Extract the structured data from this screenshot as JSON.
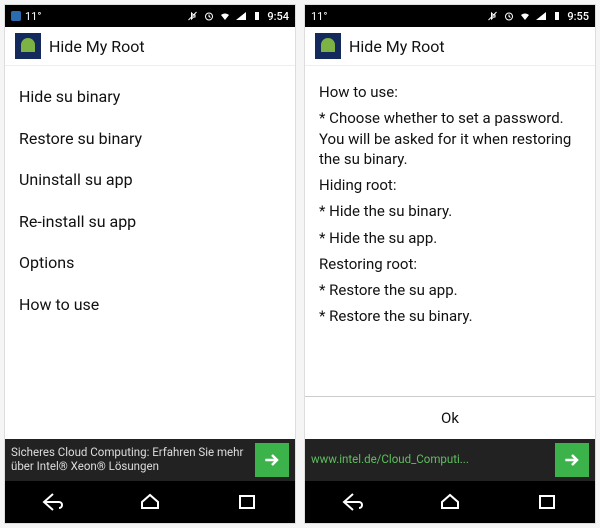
{
  "left": {
    "status": {
      "temp": "11°",
      "time": "9:54"
    },
    "app_title": "Hide My Root",
    "menu": [
      "Hide su binary",
      "Restore su binary",
      "Uninstall su app",
      "Re-install su app",
      "Options",
      "How to use"
    ],
    "ad_text": "Sicheres Cloud Computing: Erfahren Sie mehr über Intel® Xeon® Lösungen"
  },
  "right": {
    "status": {
      "temp": "11°",
      "time": "9:55"
    },
    "app_title": "Hide My Root",
    "instructions": {
      "heading": "How to use:",
      "p1": "* Choose whether to set a password. You will be asked for it when restoring the su binary.",
      "h2": "Hiding root:",
      "p2a": "* Hide the su binary.",
      "p2b": "* Hide the su app.",
      "h3": "Restoring root:",
      "p3a": "* Restore the su app.",
      "p3b": "* Restore the su binary."
    },
    "ok_label": "Ok",
    "ad_text": "www.intel.de/Cloud_Computi..."
  }
}
